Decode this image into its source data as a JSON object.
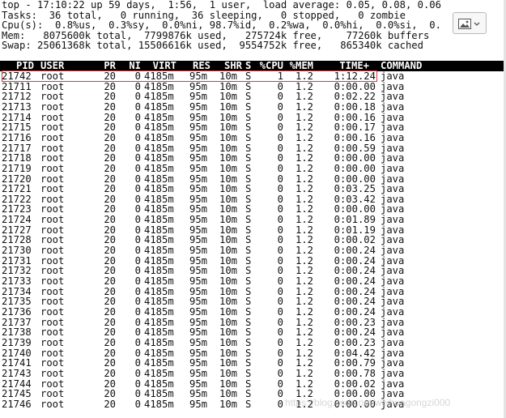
{
  "summary": {
    "line1": "top - 17:10:22 up 59 days,  1:56,  1 user,  load average: 0.05, 0.08, 0.06",
    "line2": "Tasks:  36 total,   0 running,  36 sleeping,   0 stopped,   0 zombie",
    "line3": "Cpu(s):  0.8%us,  0.3%sy,  0.0%ni, 98.7%id,  0.2%wa,  0.0%hi,  0.0%si,  0.",
    "line4": "Mem:   8075600k total,  7799876k used,   275724k free,    77260k buffers",
    "line5": "Swap: 25061368k total, 15506616k used,  9554752k free,   865340k cached"
  },
  "columns": [
    "PID",
    "USER",
    "PR",
    "NI",
    "VIRT",
    "RES",
    "SHR",
    "S",
    "%CPU",
    "%MEM",
    "TIME+",
    "COMMAND"
  ],
  "rows": [
    [
      "21742",
      "root",
      "20",
      "0",
      "4185m",
      "95m",
      "10m",
      "S",
      "1",
      "1.2",
      "1:12.24",
      "java"
    ],
    [
      "21711",
      "root",
      "20",
      "0",
      "4185m",
      "95m",
      "10m",
      "S",
      "0",
      "1.2",
      "0:00.00",
      "java"
    ],
    [
      "21712",
      "root",
      "20",
      "0",
      "4185m",
      "95m",
      "10m",
      "S",
      "0",
      "1.2",
      "0:02.22",
      "java"
    ],
    [
      "21713",
      "root",
      "20",
      "0",
      "4185m",
      "95m",
      "10m",
      "S",
      "0",
      "1.2",
      "0:00.18",
      "java"
    ],
    [
      "21714",
      "root",
      "20",
      "0",
      "4185m",
      "95m",
      "10m",
      "S",
      "0",
      "1.2",
      "0:00.16",
      "java"
    ],
    [
      "21715",
      "root",
      "20",
      "0",
      "4185m",
      "95m",
      "10m",
      "S",
      "0",
      "1.2",
      "0:00.17",
      "java"
    ],
    [
      "21716",
      "root",
      "20",
      "0",
      "4185m",
      "95m",
      "10m",
      "S",
      "0",
      "1.2",
      "0:00.16",
      "java"
    ],
    [
      "21717",
      "root",
      "20",
      "0",
      "4185m",
      "95m",
      "10m",
      "S",
      "0",
      "1.2",
      "0:00.59",
      "java"
    ],
    [
      "21718",
      "root",
      "20",
      "0",
      "4185m",
      "95m",
      "10m",
      "S",
      "0",
      "1.2",
      "0:00.00",
      "java"
    ],
    [
      "21719",
      "root",
      "20",
      "0",
      "4185m",
      "95m",
      "10m",
      "S",
      "0",
      "1.2",
      "0:00.00",
      "java"
    ],
    [
      "21720",
      "root",
      "20",
      "0",
      "4185m",
      "95m",
      "10m",
      "S",
      "0",
      "1.2",
      "0:00.00",
      "java"
    ],
    [
      "21721",
      "root",
      "20",
      "0",
      "4185m",
      "95m",
      "10m",
      "S",
      "0",
      "1.2",
      "0:03.25",
      "java"
    ],
    [
      "21722",
      "root",
      "20",
      "0",
      "4185m",
      "95m",
      "10m",
      "S",
      "0",
      "1.2",
      "0:03.42",
      "java"
    ],
    [
      "21723",
      "root",
      "20",
      "0",
      "4185m",
      "95m",
      "10m",
      "S",
      "0",
      "1.2",
      "0:00.00",
      "java"
    ],
    [
      "21724",
      "root",
      "20",
      "0",
      "4185m",
      "95m",
      "10m",
      "S",
      "0",
      "1.2",
      "0:01.89",
      "java"
    ],
    [
      "21727",
      "root",
      "20",
      "0",
      "4185m",
      "95m",
      "10m",
      "S",
      "0",
      "1.2",
      "0:01.19",
      "java"
    ],
    [
      "21728",
      "root",
      "20",
      "0",
      "4185m",
      "95m",
      "10m",
      "S",
      "0",
      "1.2",
      "0:00.02",
      "java"
    ],
    [
      "21730",
      "root",
      "20",
      "0",
      "4185m",
      "95m",
      "10m",
      "S",
      "0",
      "1.2",
      "0:00.24",
      "java"
    ],
    [
      "21731",
      "root",
      "20",
      "0",
      "4185m",
      "95m",
      "10m",
      "S",
      "0",
      "1.2",
      "0:00.24",
      "java"
    ],
    [
      "21732",
      "root",
      "20",
      "0",
      "4185m",
      "95m",
      "10m",
      "S",
      "0",
      "1.2",
      "0:00.24",
      "java"
    ],
    [
      "21733",
      "root",
      "20",
      "0",
      "4185m",
      "95m",
      "10m",
      "S",
      "0",
      "1.2",
      "0:00.24",
      "java"
    ],
    [
      "21734",
      "root",
      "20",
      "0",
      "4185m",
      "95m",
      "10m",
      "S",
      "0",
      "1.2",
      "0:00.24",
      "java"
    ],
    [
      "21735",
      "root",
      "20",
      "0",
      "4185m",
      "95m",
      "10m",
      "S",
      "0",
      "1.2",
      "0:00.24",
      "java"
    ],
    [
      "21736",
      "root",
      "20",
      "0",
      "4185m",
      "95m",
      "10m",
      "S",
      "0",
      "1.2",
      "0:00.24",
      "java"
    ],
    [
      "21737",
      "root",
      "20",
      "0",
      "4185m",
      "95m",
      "10m",
      "S",
      "0",
      "1.2",
      "0:00.23",
      "java"
    ],
    [
      "21738",
      "root",
      "20",
      "0",
      "4185m",
      "95m",
      "10m",
      "S",
      "0",
      "1.2",
      "0:00.24",
      "java"
    ],
    [
      "21739",
      "root",
      "20",
      "0",
      "4185m",
      "95m",
      "10m",
      "S",
      "0",
      "1.2",
      "0:00.23",
      "java"
    ],
    [
      "21740",
      "root",
      "20",
      "0",
      "4185m",
      "95m",
      "10m",
      "S",
      "0",
      "1.2",
      "0:04.42",
      "java"
    ],
    [
      "21741",
      "root",
      "20",
      "0",
      "4185m",
      "95m",
      "10m",
      "S",
      "0",
      "1.2",
      "0:00.79",
      "java"
    ],
    [
      "21743",
      "root",
      "20",
      "0",
      "4185m",
      "95m",
      "10m",
      "S",
      "0",
      "1.2",
      "0:00.78",
      "java"
    ],
    [
      "21744",
      "root",
      "20",
      "0",
      "4185m",
      "95m",
      "10m",
      "S",
      "0",
      "1.2",
      "0:00.02",
      "java"
    ],
    [
      "21745",
      "root",
      "20",
      "0",
      "4185m",
      "95m",
      "10m",
      "S",
      "0",
      "1.2",
      "0:00.00",
      "java"
    ],
    [
      "21746",
      "root",
      "20",
      "0",
      "4185m",
      "95m",
      "10m",
      "S",
      "0",
      "1.2",
      "0:00.00",
      "java"
    ]
  ],
  "highlight_row_index": 0,
  "colors": {
    "header_bg": "#000000",
    "header_fg": "#ffffff",
    "highlight_border": "#d23c3c",
    "text": "#111111"
  },
  "image_button_icon": "image-placeholder-icon",
  "watermark_text": "https://blog.csdn.net/weihuagongzi000"
}
